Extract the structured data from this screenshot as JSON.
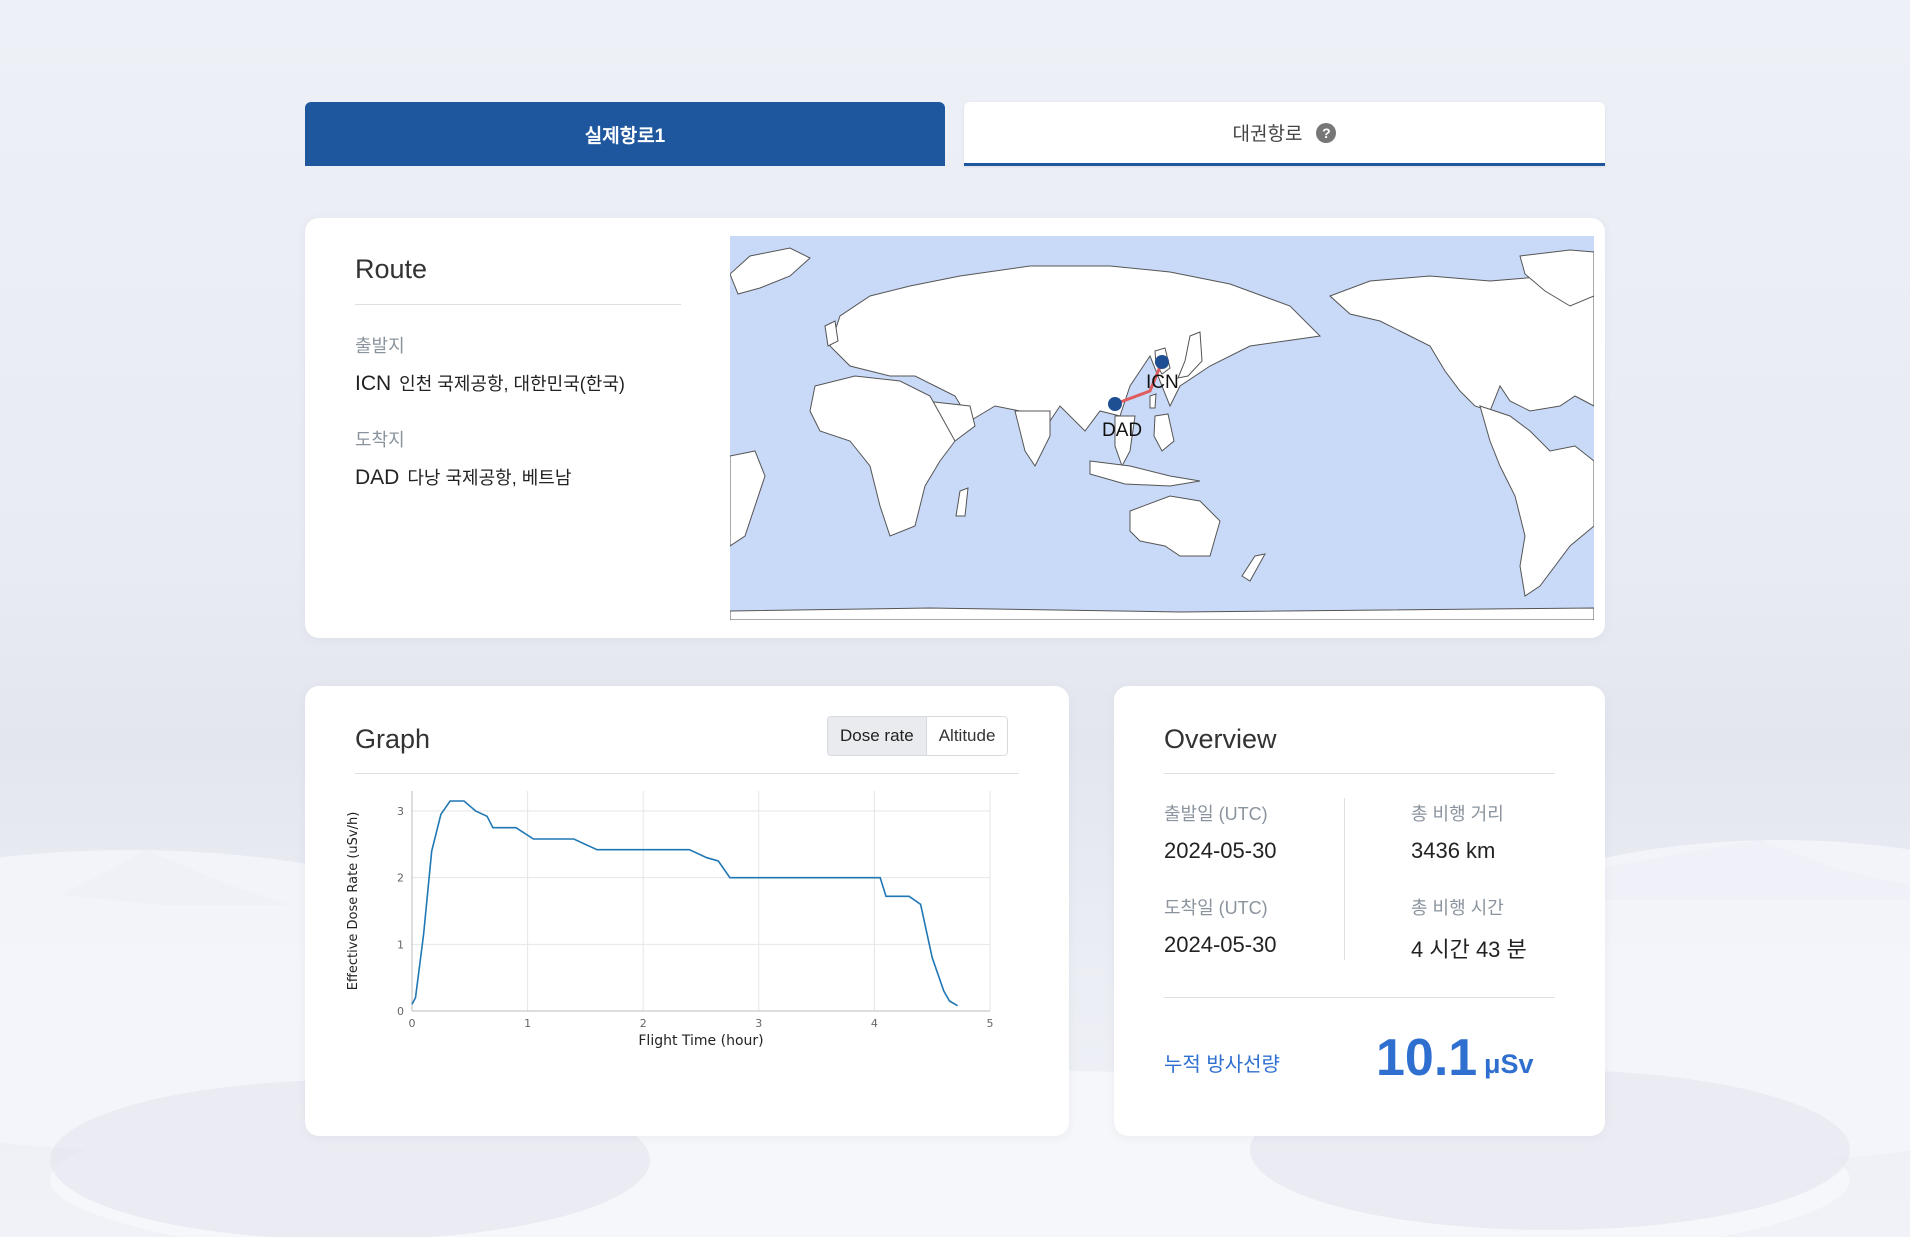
{
  "tabs": {
    "actual_route": "실제항로1",
    "great_circle": "대권항로",
    "help_icon": "question-circle-icon"
  },
  "route": {
    "title": "Route",
    "departure_label": "출발지",
    "departure_code": "ICN",
    "departure_name": "인천 국제공항, 대한민국(한국)",
    "arrival_label": "도착지",
    "arrival_code": "DAD",
    "arrival_name": "다낭 국제공항, 베트남",
    "map": {
      "origin_marker": "ICN",
      "dest_marker": "DAD",
      "ocean_color": "#c9daf8",
      "route_color": "#e05c5c",
      "marker_color": "#1f4f93"
    }
  },
  "graph": {
    "title": "Graph",
    "toggle": {
      "dose_rate": "Dose rate",
      "altitude": "Altitude",
      "selected": "Dose rate"
    }
  },
  "chart_data": {
    "type": "line",
    "xlabel": "Flight Time (hour)",
    "ylabel": "Effective Dose Rate (uSv/h)",
    "xlim": [
      0,
      5
    ],
    "ylim": [
      0,
      3.3
    ],
    "xticks": [
      0,
      1,
      2,
      3,
      4,
      5
    ],
    "yticks": [
      0,
      1,
      2,
      3
    ],
    "grid": true,
    "line_color": "#1f77b4",
    "series": [
      {
        "x": [
          0,
          0.03,
          0.1,
          0.17,
          0.25,
          0.33,
          0.45,
          0.55,
          0.65,
          0.7,
          0.9,
          1.05,
          1.4,
          1.6,
          1.85,
          2.4,
          2.55,
          2.65,
          2.75,
          3.1,
          3.4,
          3.8,
          4.05,
          4.1,
          4.3,
          4.4,
          4.5,
          4.6,
          4.65,
          4.72
        ],
        "y": [
          0.1,
          0.2,
          1.15,
          2.4,
          2.95,
          3.15,
          3.15,
          3.0,
          2.92,
          2.75,
          2.75,
          2.58,
          2.58,
          2.42,
          2.42,
          2.42,
          2.3,
          2.25,
          2.0,
          2.0,
          2.0,
          2.0,
          2.0,
          1.72,
          1.72,
          1.6,
          0.8,
          0.3,
          0.15,
          0.08
        ]
      }
    ]
  },
  "overview": {
    "title": "Overview",
    "dep_date_label": "출발일 (UTC)",
    "dep_date": "2024-05-30",
    "arr_date_label": "도착일 (UTC)",
    "arr_date": "2024-05-30",
    "distance_label": "총 비행 거리",
    "distance": "3436 km",
    "duration_label": "총 비행 시간",
    "duration": "4 시간 43 분",
    "dose_label": "누적 방사선량",
    "dose_value": "10.1",
    "dose_unit": "μSv"
  }
}
